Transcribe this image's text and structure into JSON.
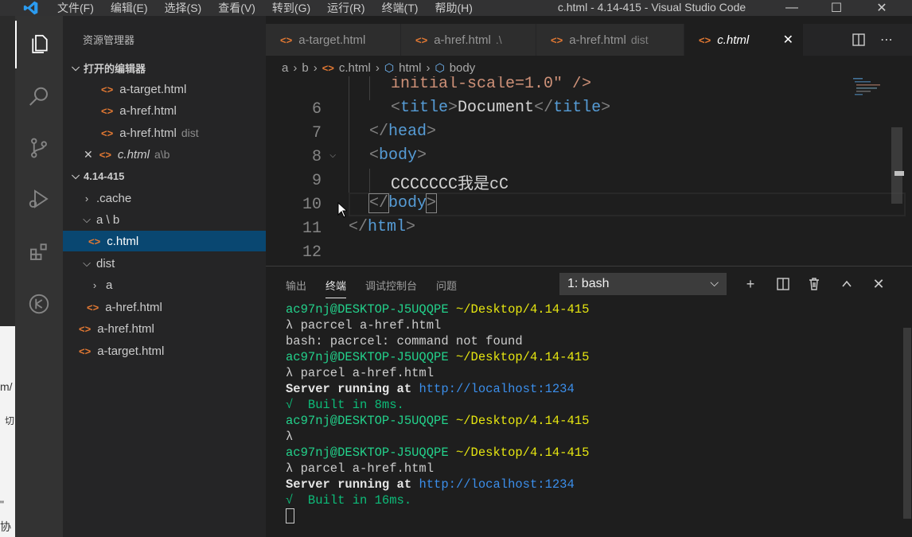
{
  "titlebar": {
    "menu": [
      "文件(F)",
      "编辑(E)",
      "选择(S)",
      "查看(V)",
      "转到(G)",
      "运行(R)",
      "终端(T)",
      "帮助(H)"
    ],
    "title": "c.html - 4.14-415 - Visual Studio Code",
    "minimize": "—",
    "maximize": "☐",
    "close": "✕"
  },
  "strip": {
    "text1": "m/",
    "text2": "切",
    "text3": "\"",
    "text4": "协"
  },
  "sidebar": {
    "title": "资源管理器",
    "open_editors_label": "打开的编辑器",
    "open_editors": [
      {
        "name": "a-target.html",
        "hint": ""
      },
      {
        "name": "a-href.html",
        "hint": ""
      },
      {
        "name": "a-href.html",
        "hint": "dist"
      },
      {
        "name": "c.html",
        "hint": "a\\b"
      }
    ],
    "folder_label": "4.14-415",
    "tree": [
      {
        "name": ".cache",
        "type": "folder",
        "collapsed": true
      },
      {
        "name": "a \\ b",
        "type": "folder",
        "collapsed": false
      },
      {
        "name": "c.html",
        "type": "file"
      },
      {
        "name": "dist",
        "type": "folder",
        "collapsed": false
      },
      {
        "name": "a",
        "type": "folder",
        "collapsed": true
      },
      {
        "name": "a-href.html",
        "type": "file"
      },
      {
        "name": "a-href.html",
        "type": "file"
      },
      {
        "name": "a-target.html",
        "type": "file"
      }
    ]
  },
  "tabs": [
    {
      "label": "a-target.html",
      "hint": ""
    },
    {
      "label": "a-href.html",
      "hint": ".\\"
    },
    {
      "label": "a-href.html",
      "hint": "dist"
    },
    {
      "label": "c.html",
      "hint": "",
      "close": "✕"
    }
  ],
  "breadcrumb": {
    "a": "a",
    "b": "b",
    "file": "c.html",
    "html": "html",
    "body": "body"
  },
  "editor": {
    "line_numbers": [
      "6",
      "7",
      "8",
      "9",
      "10",
      "11",
      "12"
    ],
    "partial_line": "initial-scale=1.0\" />",
    "line6": {
      "open": "<",
      "tag": "title",
      "close": ">",
      "text": "Document",
      "end_open": "</",
      "end_close": ">"
    },
    "line7": {
      "open": "</",
      "tag": "head",
      "close": ">"
    },
    "line8": {
      "open": "<",
      "tag": "body",
      "close": ">"
    },
    "line9": {
      "text": "CCCCCCC我是cC"
    },
    "line10": {
      "open": "</",
      "tag": "body",
      "close": ">"
    },
    "line11": {
      "open": "</",
      "tag": "html",
      "close": ">"
    }
  },
  "panel": {
    "tabs": [
      "输出",
      "终端",
      "调试控制台",
      "问题"
    ],
    "active_tab": "终端",
    "terminal_select": "1: bash",
    "terminal_lines": {
      "l1_user": "ac97nj@DESKTOP-J5UQQPE",
      "l1_path": "~/Desktop/4.14-415",
      "l2": "λ pacrcel a-href.html",
      "l3": "bash: pacrcel: command not found",
      "l4_user": "ac97nj@DESKTOP-J5UQQPE",
      "l4_path": "~/Desktop/4.14-415",
      "l5": "λ parcel a-href.html",
      "l6_bold": "Server running at",
      "l6_url": "http://localhost:1234",
      "l7": "√  Built in 8ms.",
      "l8_user": "ac97nj@DESKTOP-J5UQQPE",
      "l8_path": "~/Desktop/4.14-415",
      "l9": "λ",
      "l10_user": "ac97nj@DESKTOP-J5UQQPE",
      "l10_path": "~/Desktop/4.14-415",
      "l11": "λ parcel a-href.html",
      "l12_bold": "Server running at",
      "l12_url": "http://localhost:1234",
      "l13": "√  Built in 16ms."
    }
  },
  "colors": {
    "accent": "#094771",
    "file_icon": "#e37933",
    "terminal_green": "#23d18b",
    "terminal_yellow": "#e5e510",
    "terminal_blue": "#3b8eea"
  }
}
